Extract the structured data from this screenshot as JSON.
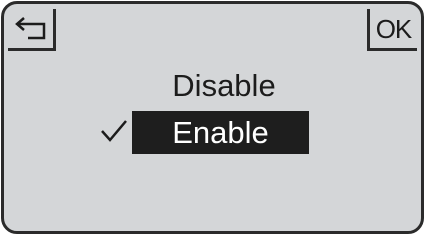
{
  "header": {
    "back_icon": "back-arrow-icon",
    "ok_label": "OK"
  },
  "options": [
    {
      "label": "Disable",
      "selected": false
    },
    {
      "label": "Enable",
      "selected": true,
      "check_icon": "checkmark-icon"
    }
  ],
  "colors": {
    "screen_background": "#d4d6d8",
    "highlight_background": "#1e1e1e",
    "highlight_text": "#ffffff",
    "border": "#2b2b2b"
  }
}
